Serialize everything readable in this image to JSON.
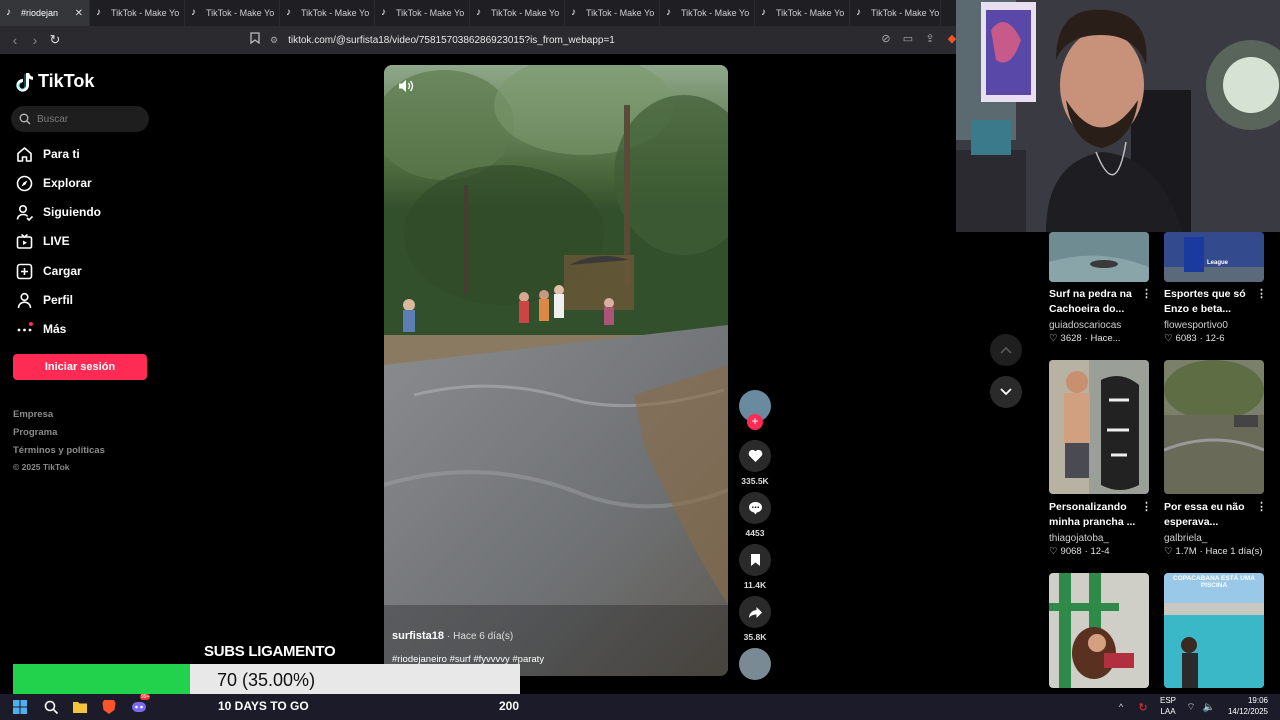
{
  "browser": {
    "tabs": [
      {
        "label": "#riodejan",
        "active": true
      },
      {
        "label": "TikTok - Make Yo"
      },
      {
        "label": "TikTok - Make Yo"
      },
      {
        "label": "TikTok - Make Yo"
      },
      {
        "label": "TikTok - Make Yo"
      },
      {
        "label": "TikTok - Make Yo"
      },
      {
        "label": "TikTok - Make Yo"
      },
      {
        "label": "TikTok - Make Yo"
      },
      {
        "label": "TikTok - Make Yo"
      },
      {
        "label": "TikTok - Make Yo"
      }
    ],
    "url": "tiktok.com/@surfista18/video/7581570386286923015?is_from_webapp=1"
  },
  "sidebar": {
    "logo": "TikTok",
    "search_placeholder": "Buscar",
    "items": [
      {
        "label": "Para ti",
        "icon": "home-icon"
      },
      {
        "label": "Explorar",
        "icon": "compass-icon"
      },
      {
        "label": "Siguiendo",
        "icon": "following-icon"
      },
      {
        "label": "LIVE",
        "icon": "live-icon"
      },
      {
        "label": "Cargar",
        "icon": "upload-icon"
      },
      {
        "label": "Perfil",
        "icon": "profile-icon"
      },
      {
        "label": "Más",
        "icon": "more-icon"
      }
    ],
    "login_label": "Iniciar sesión",
    "footer": [
      "Empresa",
      "Programa",
      "Términos y políticas",
      "© 2025 TikTok"
    ]
  },
  "video": {
    "author": "surfista18",
    "time": "· Hace 6 día(s)",
    "tags": "#riodejaneiro #surf #fyvvvvy #paraty"
  },
  "actions": {
    "likes": "335.5K",
    "comments": "4453",
    "saves": "11.4K",
    "shares": "35.8K"
  },
  "recommendations": [
    {
      "title1": "Surf na pedra na",
      "title2": "Cachoeira do...",
      "user": "guiadoscariocas",
      "likes": "3628",
      "date": "· Hace..."
    },
    {
      "title1": "Esportes que só",
      "title2": "Enzo e beta...",
      "user": "flowesportivo0",
      "likes": "6083",
      "date": "· 12-6"
    },
    {
      "title1": "Personalizando",
      "title2": "minha prancha ...",
      "user": "thiagojatoba_",
      "likes": "9068",
      "date": "· 12-4"
    },
    {
      "title1": "Por essa eu não",
      "title2": "esperava...",
      "user": "galbriela_",
      "likes": "1.7M",
      "date": "· Hace 1 día(s)"
    }
  ],
  "thumb_captions": {
    "league": "League",
    "copacabana": "COPACABANA ESTÁ UMA PISCINA"
  },
  "overlay": {
    "subs_title": "SUBS LIGAMENTO",
    "progress_text": "70 (35.00%)",
    "progress_fraction": 0.35,
    "days_left": "10 DAYS TO GO",
    "goal": "200"
  },
  "taskbar": {
    "lang1": "ESP",
    "lang2": "LAA",
    "time": "19:06",
    "date": "14/12/2025",
    "discord_badge": "99+"
  },
  "colors": {
    "accent": "#fe2c55",
    "progress": "#22d14c"
  }
}
